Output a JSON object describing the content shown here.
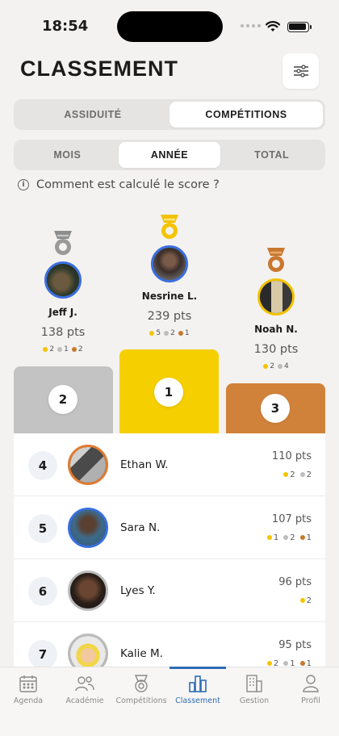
{
  "status": {
    "time": "18:54"
  },
  "header": {
    "title": "CLASSEMENT"
  },
  "tabs_primary": [
    "ASSIDUITÉ",
    "COMPÉTITIONS"
  ],
  "tabs_primary_active": 1,
  "tabs_period": [
    "MOIS",
    "ANNÉE",
    "TOTAL"
  ],
  "tabs_period_active": 1,
  "info": {
    "text": "Comment est calculé le score ?"
  },
  "podium": [
    {
      "rank": "2",
      "name": "Jeff J.",
      "points": "138 pts",
      "gold": "2",
      "silver": "1",
      "bronze": "2"
    },
    {
      "rank": "1",
      "name": "Nesrine L.",
      "points": "239 pts",
      "gold": "5",
      "silver": "2",
      "bronze": "1"
    },
    {
      "rank": "3",
      "name": "Noah N.",
      "points": "130 pts",
      "gold": "2",
      "silver": "4"
    }
  ],
  "colors": {
    "gold": "#f5c400",
    "silver": "#bdbdbd",
    "bronze": "#c8782f",
    "accent": "#2e6db4"
  },
  "ranking": [
    {
      "rank": "4",
      "name": "Ethan W.",
      "points": "110 pts",
      "gold": "2",
      "silver": "2"
    },
    {
      "rank": "5",
      "name": "Sara N.",
      "points": "107 pts",
      "gold": "1",
      "silver": "2",
      "bronze": "1"
    },
    {
      "rank": "6",
      "name": "Lyes Y.",
      "points": "96 pts",
      "gold": "2"
    },
    {
      "rank": "7",
      "name": "Kalie M.",
      "points": "95 pts",
      "gold": "2",
      "silver": "1",
      "bronze": "1"
    }
  ],
  "tabbar": [
    {
      "label": "Agenda",
      "icon": "calendar-icon"
    },
    {
      "label": "Académie",
      "icon": "people-icon"
    },
    {
      "label": "Compétitions",
      "icon": "medal-icon"
    },
    {
      "label": "Classement",
      "icon": "bar-chart-icon"
    },
    {
      "label": "Gestion",
      "icon": "building-icon"
    },
    {
      "label": "Profil",
      "icon": "person-icon"
    }
  ],
  "tabbar_active": 3
}
